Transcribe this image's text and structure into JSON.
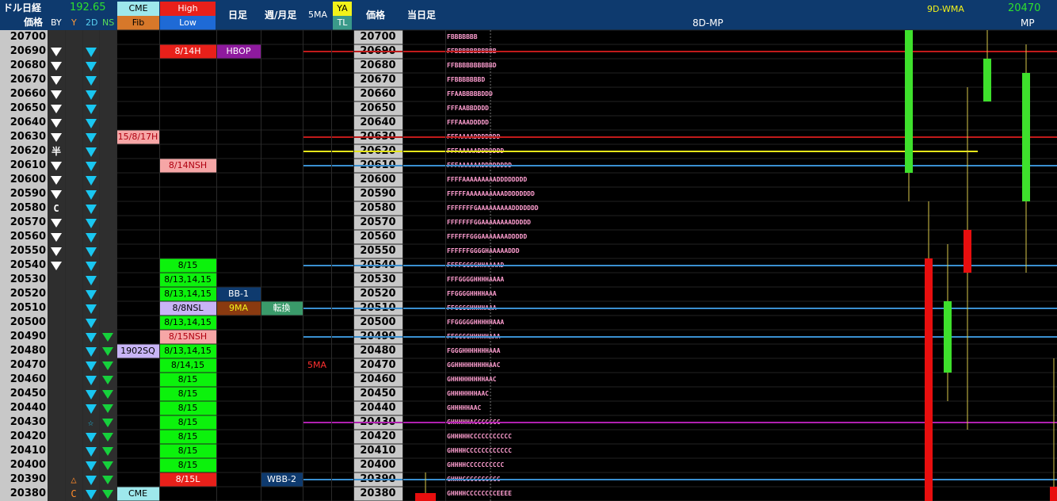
{
  "header": {
    "title": "ドル日経",
    "price_value": "192.65",
    "col_price": "価格",
    "col_by": "BY",
    "col_y": "Y",
    "col_2d": "2D",
    "col_ns": "NS",
    "cme_label": "CME",
    "fib_label": "Fib",
    "high_label": "High",
    "low_label": "Low",
    "daily_label": "日足",
    "weekly_label": "週/月足",
    "ma5_label": "5MA",
    "ya_label": "YA",
    "tl_label": "TL",
    "price2_label": "価格",
    "today_label": "当日足",
    "mp8d_label": "8D-MP",
    "wma_label": "9D-WMA",
    "wma_value": "20470",
    "mp_label": "MP"
  },
  "colors": {
    "header_bg": "#0e3a6e",
    "price_bg": "#c8c8c8",
    "cyan_marker": "#19c6f0",
    "green_marker": "#16d03c",
    "green_cell": "#0cf20c",
    "red_cell": "#e8201a",
    "pink_cell": "#f6a6a6",
    "candle_green": "#3ee02c",
    "candle_red": "#e80e0e"
  },
  "rows": [
    {
      "price": "20700",
      "by": "",
      "y": "",
      "d2": "",
      "ns": "",
      "cme": "",
      "hl": "",
      "d": "",
      "w": "",
      "ma5": "",
      "mp": "FBBBBBBB"
    },
    {
      "price": "20690",
      "by": "tri",
      "y": "",
      "d2": "tri",
      "ns": "",
      "cme": "",
      "hl": "8/14H",
      "d": "HBOP",
      "w": "",
      "ma5": "",
      "mp": "FFBBBBBBBBBBB"
    },
    {
      "price": "20680",
      "by": "tri",
      "y": "",
      "d2": "tri",
      "ns": "",
      "cme": "",
      "hl": "",
      "d": "",
      "w": "",
      "ma5": "",
      "mp": "FFBBBBBBBBBBD"
    },
    {
      "price": "20670",
      "by": "tri",
      "y": "",
      "d2": "tri",
      "ns": "",
      "cme": "",
      "hl": "",
      "d": "",
      "w": "",
      "ma5": "",
      "mp": "FFBBBBBBBD"
    },
    {
      "price": "20660",
      "by": "tri",
      "y": "",
      "d2": "tri",
      "ns": "",
      "cme": "",
      "hl": "",
      "d": "",
      "w": "",
      "ma5": "",
      "mp": "FFAABBBBBDDD"
    },
    {
      "price": "20650",
      "by": "tri",
      "y": "",
      "d2": "tri",
      "ns": "",
      "cme": "",
      "hl": "",
      "d": "",
      "w": "",
      "ma5": "",
      "mp": "FFFAABBDDDD"
    },
    {
      "price": "20640",
      "by": "tri",
      "y": "",
      "d2": "tri",
      "ns": "",
      "cme": "",
      "hl": "",
      "d": "",
      "w": "",
      "ma5": "",
      "mp": "FFFAAADDDDD"
    },
    {
      "price": "20630",
      "by": "tri",
      "y": "",
      "d2": "tri",
      "ns": "",
      "cme": "15/8/17H",
      "hl": "",
      "d": "",
      "w": "",
      "ma5": "",
      "mp": "FFFAAAADDDDDDD"
    },
    {
      "price": "20620",
      "by": "半",
      "y": "",
      "d2": "tri",
      "ns": "",
      "cme": "",
      "hl": "",
      "d": "",
      "w": "",
      "ma5": "",
      "mp": "FFFAAAAADDDDDDD"
    },
    {
      "price": "20610",
      "by": "tri",
      "y": "",
      "d2": "tri",
      "ns": "",
      "cme": "",
      "hl": "8/14NSH",
      "d": "",
      "w": "",
      "ma5": "",
      "mp": "FFFAAAAAADDDDDDDD"
    },
    {
      "price": "20600",
      "by": "tri",
      "y": "",
      "d2": "tri",
      "ns": "",
      "cme": "",
      "hl": "",
      "d": "",
      "w": "",
      "ma5": "",
      "mp": "FFFFAAAAAAAAADDDDDDDD"
    },
    {
      "price": "20590",
      "by": "tri",
      "y": "",
      "d2": "tri",
      "ns": "",
      "cme": "",
      "hl": "",
      "d": "",
      "w": "",
      "ma5": "",
      "mp": "FFFFFAAAAAAAAAADDDDDDDD"
    },
    {
      "price": "20580",
      "by": "C",
      "y": "",
      "d2": "tri",
      "ns": "",
      "cme": "",
      "hl": "",
      "d": "",
      "w": "",
      "ma5": "",
      "mp": "FFFFFFFGAAAAAAAAADDDDDDD"
    },
    {
      "price": "20570",
      "by": "tri",
      "y": "",
      "d2": "tri",
      "ns": "",
      "cme": "",
      "hl": "",
      "d": "",
      "w": "",
      "ma5": "",
      "mp": "FFFFFFFGGAAAAAAAADDDDD"
    },
    {
      "price": "20560",
      "by": "tri",
      "y": "",
      "d2": "tri",
      "ns": "",
      "cme": "",
      "hl": "",
      "d": "",
      "w": "",
      "ma5": "",
      "mp": "FFFFFFGGGAAAAAAADDDDD"
    },
    {
      "price": "20550",
      "by": "tri",
      "y": "",
      "d2": "tri",
      "ns": "",
      "cme": "",
      "hl": "",
      "d": "",
      "w": "",
      "ma5": "",
      "mp": "FFFFFFGGGGHAAAAADDD"
    },
    {
      "price": "20540",
      "by": "tri",
      "y": "",
      "d2": "tri",
      "ns": "",
      "cme": "",
      "hl": "8/15",
      "d": "",
      "w": "",
      "ma5": "",
      "mp": "FFFFGGGGHHAAAAD"
    },
    {
      "price": "20530",
      "by": "",
      "y": "",
      "d2": "tri",
      "ns": "",
      "cme": "",
      "hl": "8/13,14,15",
      "d": "",
      "w": "",
      "ma5": "",
      "mp": "FFFGGGGHHHHAAAA"
    },
    {
      "price": "20520",
      "by": "",
      "y": "",
      "d2": "tri",
      "ns": "",
      "cme": "",
      "hl": "8/13,14,15",
      "d": "BB-1",
      "w": "",
      "ma5": "",
      "mp": "FFGGGGHHHHAAA"
    },
    {
      "price": "20510",
      "by": "",
      "y": "",
      "d2": "tri",
      "ns": "",
      "cme": "",
      "hl": "8/8NSL",
      "d": "9MA",
      "w": "転換",
      "ma5": "",
      "mp": "FFGGGGHHHHAAA"
    },
    {
      "price": "20500",
      "by": "",
      "y": "",
      "d2": "tri",
      "ns": "",
      "cme": "",
      "hl": "8/13,14,15",
      "d": "",
      "w": "",
      "ma5": "",
      "mp": "FFGGGGGHHHHHAAA"
    },
    {
      "price": "20490",
      "by": "",
      "y": "",
      "d2": "tri",
      "ns": "tri",
      "cme": "",
      "hl": "8/15NSH",
      "d": "",
      "w": "",
      "ma5": "",
      "mp": "FFGGGGHHHHHAAA"
    },
    {
      "price": "20480",
      "by": "",
      "y": "",
      "d2": "tri",
      "ns": "tri",
      "cme": "1902SQ",
      "hl": "8/13,14,15",
      "d": "",
      "w": "",
      "ma5": "",
      "mp": "FGGGHHHHHHHAAA"
    },
    {
      "price": "20470",
      "by": "",
      "y": "",
      "d2": "tri",
      "ns": "tri",
      "cme": "",
      "hl": "8/14,15",
      "d": "",
      "w": "",
      "ma5": "5MA",
      "mp": "GGHHHHHHHHHAAC"
    },
    {
      "price": "20460",
      "by": "",
      "y": "",
      "d2": "tri",
      "ns": "tri",
      "cme": "",
      "hl": "8/15",
      "d": "",
      "w": "",
      "ma5": "",
      "mp": "GHHHHHHHHHAAC"
    },
    {
      "price": "20450",
      "by": "",
      "y": "",
      "d2": "tri",
      "ns": "tri",
      "cme": "",
      "hl": "8/15",
      "d": "",
      "w": "",
      "ma5": "",
      "mp": "GHHHHHHHAAC"
    },
    {
      "price": "20440",
      "by": "",
      "y": "",
      "d2": "tri",
      "ns": "tri",
      "cme": "",
      "hl": "8/15",
      "d": "",
      "w": "",
      "ma5": "",
      "mp": "GHHHHHAAC"
    },
    {
      "price": "20430",
      "by": "",
      "y": "",
      "d2": "star",
      "ns": "tri",
      "cme": "",
      "hl": "8/15",
      "d": "",
      "w": "",
      "ma5": "",
      "mp": "GHHHHHACCCCCCC"
    },
    {
      "price": "20420",
      "by": "",
      "y": "",
      "d2": "tri",
      "ns": "tri",
      "cme": "",
      "hl": "8/15",
      "d": "",
      "w": "",
      "ma5": "",
      "mp": "GHHHHHCCCCCCCCCCC"
    },
    {
      "price": "20410",
      "by": "",
      "y": "",
      "d2": "tri",
      "ns": "tri",
      "cme": "",
      "hl": "8/15",
      "d": "",
      "w": "",
      "ma5": "",
      "mp": "GHHHHCCCCCCCCCCCC"
    },
    {
      "price": "20400",
      "by": "",
      "y": "",
      "d2": "tri",
      "ns": "tri",
      "cme": "",
      "hl": "8/15",
      "d": "",
      "w": "",
      "ma5": "",
      "mp": "GHHHHCCCCCCCCCC"
    },
    {
      "price": "20390",
      "by": "",
      "y": "△",
      "d2": "tri",
      "ns": "tri",
      "cme": "",
      "hl": "8/15L",
      "d": "",
      "w": "WBB-2",
      "ma5": "",
      "mp": "GHHHCCCCCCCCCC"
    },
    {
      "price": "20380",
      "by": "",
      "y": "C",
      "d2": "tri",
      "ns": "tri",
      "cme": "CME",
      "hl": "",
      "d": "",
      "w": "",
      "ma5": "",
      "mp": "GHHHHCCCCCCCCEEEE"
    }
  ],
  "cell_styles": {
    "8/14H": "red",
    "HBOP": "purple",
    "15/8/17H": "pink",
    "8/14NSH": "pink",
    "8/15": "green",
    "8/13,14,15": "green",
    "BB-1": "navy",
    "8/8NSL": "lavender",
    "9MA": "brown",
    "転換": "teal",
    "8/15NSH": "pink",
    "1902SQ": "lavender",
    "8/14,15": "green",
    "5MA": "redtext",
    "8/15L": "red",
    "WBB-2": "navy",
    "CME": "cyan"
  },
  "levels": [
    {
      "name": "HBOP",
      "price": 20690,
      "color": "#c01a1a"
    },
    {
      "name": "20630",
      "price": 20630,
      "color": "#c01a1a"
    },
    {
      "name": "20620",
      "price": 20620,
      "color": "#e6e61a"
    },
    {
      "name": "20610",
      "price": 20610,
      "color": "#3a8fd0"
    },
    {
      "name": "20540",
      "price": 20540,
      "color": "#3a8fd0"
    },
    {
      "name": "20510",
      "price": 20510,
      "color": "#3a8fd0"
    },
    {
      "name": "20490",
      "price": 20490,
      "color": "#3a8fd0"
    },
    {
      "name": "20430",
      "price": 20430,
      "color": "#b020b0"
    },
    {
      "name": "20390",
      "price": 20390,
      "color": "#3a8fd0"
    }
  ],
  "candles": [
    {
      "color": "green",
      "open": 20610,
      "close": 20700,
      "high": 20700,
      "low": 20590
    },
    {
      "color": "red",
      "open": 20540,
      "close": 20380,
      "high": 20580,
      "low": 20380
    },
    {
      "color": "green",
      "open": 20470,
      "close": 20510,
      "high": 20550,
      "low": 20450
    },
    {
      "color": "red",
      "open": 20560,
      "close": 20540,
      "high": 20660,
      "low": 20430
    },
    {
      "color": "green",
      "open": 20660,
      "close": 20680,
      "high": 20700,
      "low": 20660
    },
    {
      "color": "green",
      "open": 20590,
      "close": 20670,
      "high": 20690,
      "low": 20540
    },
    {
      "color": "red",
      "open": 20380,
      "close": 20380,
      "high": 20470,
      "low": 20380
    }
  ]
}
